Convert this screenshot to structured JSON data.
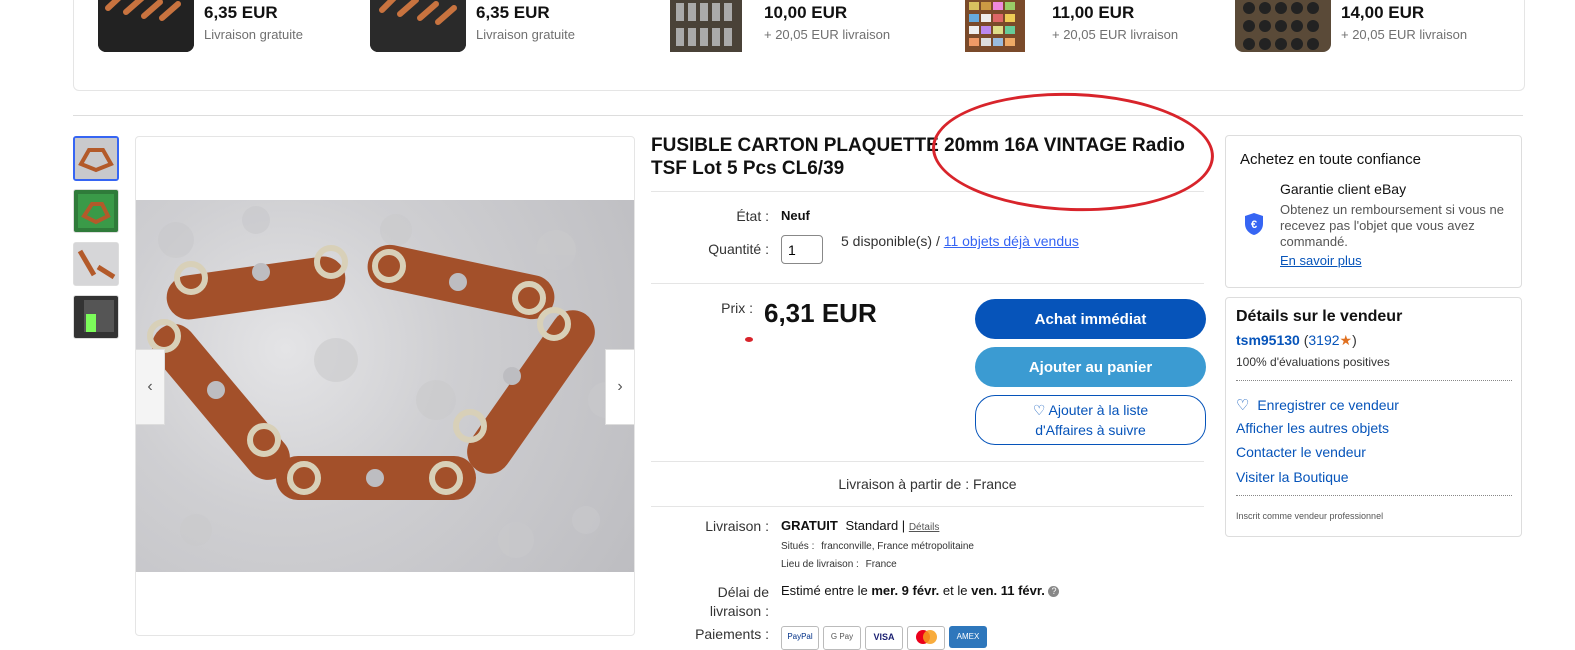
{
  "related": [
    {
      "price": "6,35 EUR",
      "shipping": "Livraison gratuite"
    },
    {
      "price": "6,35 EUR",
      "shipping": "Livraison gratuite"
    },
    {
      "price": "10,00 EUR",
      "shipping": "+ 20,05 EUR livraison"
    },
    {
      "price": "11,00 EUR",
      "shipping": "+ 20,05 EUR livraison"
    },
    {
      "price": "14,00 EUR",
      "shipping": "+ 20,05 EUR livraison"
    }
  ],
  "listing": {
    "title": "FUSIBLE CARTON PLAQUETTE 20mm 16A VINTAGE Radio TSF Lot 5 Pcs CL6/39",
    "condition_label": "État :",
    "condition_value": "Neuf",
    "quantity_label": "Quantité :",
    "quantity_value": "1",
    "available": "5 disponible(s) /",
    "sold_link": "11 objets déjà vendus",
    "price_label": "Prix :",
    "price": "6,31 EUR",
    "buy_now": "Achat immédiat",
    "add_to_cart": "Ajouter au panier",
    "watch_line1": "Ajouter à la liste",
    "watch_line2": "d'Affaires à suivre",
    "ships_from": "Livraison à partir de : France",
    "delivery_label": "Livraison :",
    "delivery_free": "GRATUIT",
    "delivery_type": "Standard |",
    "delivery_details": "Détails",
    "location_label": "Situés :",
    "location_value": "franconville, France métropolitaine",
    "delivery_place_label": "Lieu de livraison :",
    "delivery_place_value": "France",
    "delay_label_1": "Délai de",
    "delay_label_2": "livraison :",
    "delay_prefix": "Estimé entre le",
    "delay_from": "mer. 9 févr.",
    "delay_and": "et le",
    "delay_to": "ven. 11 févr.",
    "payments_label": "Paiements :",
    "payment_methods": [
      "PayPal",
      "G Pay",
      "VISA",
      "Mastercard",
      "AMEX"
    ]
  },
  "trust": {
    "title": "Achetez en toute confiance",
    "guarantee_title": "Garantie client eBay",
    "guarantee_text": "Obtenez un remboursement si vous ne recevez pas l'objet que vous avez commandé.",
    "learn_more": "En savoir plus"
  },
  "seller": {
    "title": "Détails sur le vendeur",
    "name": "tsm95130",
    "score": "3192",
    "feedback": "100% d'évaluations positives",
    "save": "Enregistrer ce vendeur",
    "other_items": "Afficher les autres objets",
    "contact": "Contacter le vendeur",
    "store": "Visiter la Boutique",
    "pro": "Inscrit comme vendeur professionnel"
  },
  "colors": {
    "primary_blue": "#0654ba",
    "cart_blue": "#3b9bd2",
    "link_blue": "#3665f3",
    "annotation_red": "#d8242b"
  }
}
